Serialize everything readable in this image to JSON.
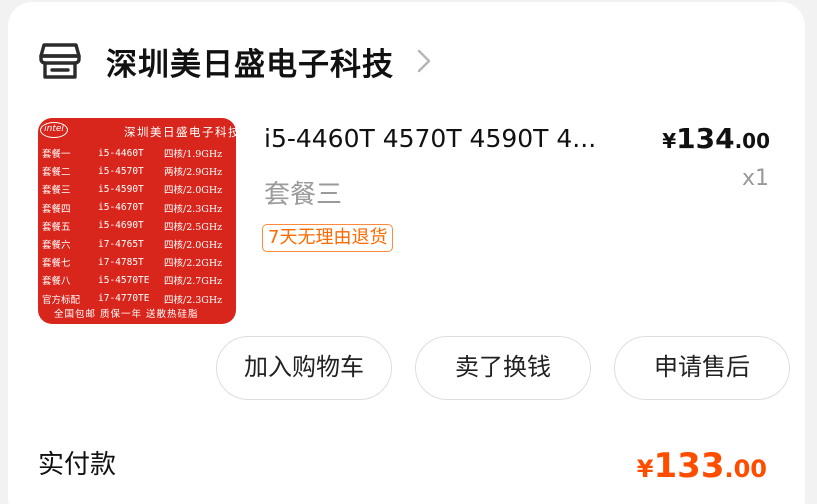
{
  "shop": {
    "name": "深圳美日盛电子科技",
    "icon": "store-icon"
  },
  "product": {
    "image": {
      "logo": "intel",
      "title": "深圳美日盛电子科技",
      "rows": [
        {
          "pkg": "套餐一",
          "model": "i5-4460T",
          "spec": "四核/1.9GHz"
        },
        {
          "pkg": "套餐二",
          "model": "i5-4570T",
          "spec": "两核/2.9GHz"
        },
        {
          "pkg": "套餐三",
          "model": "i5-4590T",
          "spec": "四核/2.0GHz"
        },
        {
          "pkg": "套餐四",
          "model": "i5-4670T",
          "spec": "四核/2.3GHz"
        },
        {
          "pkg": "套餐五",
          "model": "i5-4690T",
          "spec": "四核/2.5GHz"
        },
        {
          "pkg": "套餐六",
          "model": "i7-4765T",
          "spec": "四核/2.0GHz"
        },
        {
          "pkg": "套餐七",
          "model": "i7-4785T",
          "spec": "四核/2.2GHz"
        },
        {
          "pkg": "套餐八",
          "model": "i5-4570TE",
          "spec": "四核/2.7GHz"
        },
        {
          "pkg": "官方标配",
          "model": "i7-4770TE",
          "spec": "四核/2.3GHz"
        }
      ],
      "footer": "全国包邮  质保一年  送散热硅脂"
    },
    "title": "i5-4460T 4570T 4590T 4...",
    "variant": "套餐三",
    "badge": "7天无理由退货",
    "price": {
      "currency": "¥",
      "integer": "134",
      "decimal": ".00"
    },
    "quantity": "x1"
  },
  "actions": {
    "add_to_cart": "加入购物车",
    "resell": "卖了换钱",
    "after_sales": "申请售后"
  },
  "payment": {
    "label": "实付款",
    "currency": "¥",
    "integer": "133",
    "decimal": ".00"
  },
  "colors": {
    "accent": "#ff4d00",
    "badge": "#ff6a00",
    "thumbnail_bg": "#d9261c"
  }
}
